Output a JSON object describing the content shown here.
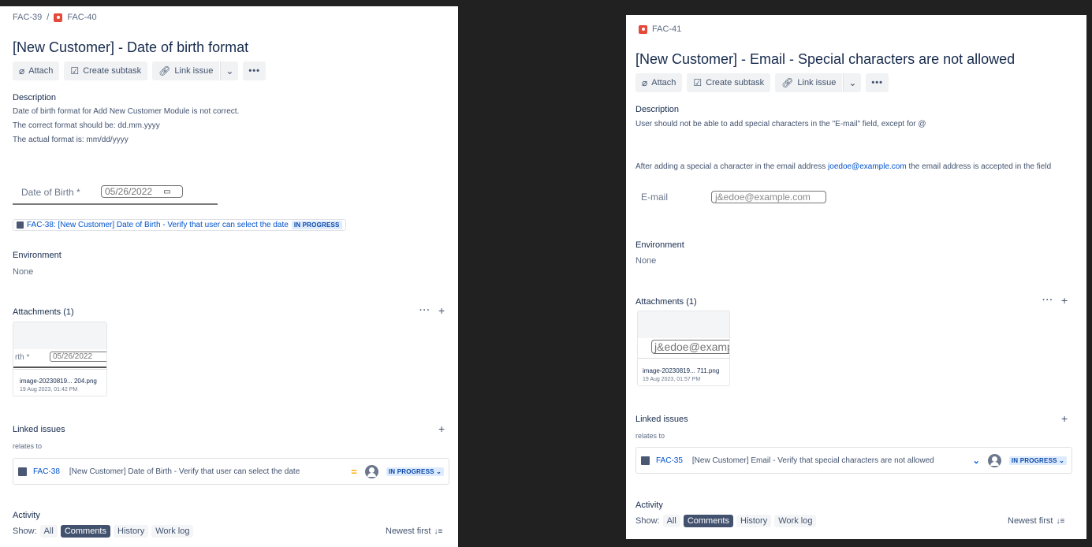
{
  "left": {
    "breadcrumb": {
      "parent": "FAC-39",
      "separator": "/",
      "current": "FAC-40"
    },
    "title": "[New Customer] - Date of birth format",
    "toolbar": {
      "attach": "Attach",
      "subtask": "Create subtask",
      "link": "Link issue"
    },
    "description": {
      "label": "Description",
      "lines": [
        "Date of birth format for Add New Customer Module is not correct.",
        "The correct format should be: dd.mm.yyyy",
        "The actual format is: mm/dd/yyyy"
      ]
    },
    "embedded_field": {
      "label": "Date of Birth *",
      "value": "05/26/2022"
    },
    "linked_chip": {
      "text": "FAC-38: [New Customer] Date of Birth - Verify that user can select the date",
      "status": "IN PROGRESS"
    },
    "environment": {
      "label": "Environment",
      "value": "None"
    },
    "attachments": {
      "label": "Attachments (1)",
      "file": {
        "crop_label": "rth *",
        "crop_value": "05/26/2022",
        "name": "image-20230819... 204.png",
        "date": "19 Aug 2023, 01:42 PM"
      }
    },
    "linked_issues": {
      "label": "Linked issues",
      "relation": "relates to",
      "issue": {
        "key": "FAC-38",
        "summary": "[New Customer] Date of Birth - Verify that user can select the date",
        "priority_icon": "priority-medium-icon",
        "status": "IN PROGRESS"
      }
    },
    "activity": {
      "label": "Activity",
      "show": "Show:",
      "filters": [
        "All",
        "Comments",
        "History",
        "Work log"
      ],
      "active_filter": "Comments",
      "sort": "Newest first"
    }
  },
  "right": {
    "breadcrumb": {
      "current": "FAC-41"
    },
    "title": "[New Customer] - Email - Special characters are not allowed",
    "toolbar": {
      "attach": "Attach",
      "subtask": "Create subtask",
      "link": "Link issue"
    },
    "description": {
      "label": "Description",
      "line1": "User should not be able to add special characters in the \"E-mail\" field, except for @",
      "line2_before": "After adding a special a character in the email address ",
      "line2_link": "joedoe@example.com",
      "line2_after": " the email address is accepted in the field"
    },
    "embedded_field": {
      "label": "E-mail",
      "value": "j&edoe@example.com"
    },
    "environment": {
      "label": "Environment",
      "value": "None"
    },
    "attachments": {
      "label": "Attachments (1)",
      "file": {
        "crop_value": "j&edoe@examp",
        "name": "image-20230819... 711.png",
        "date": "19 Aug 2023, 01:57 PM"
      }
    },
    "linked_issues": {
      "label": "Linked issues",
      "relation": "relates to",
      "issue": {
        "key": "FAC-35",
        "summary": "[New Customer] Email - Verify that special characters are not allowed",
        "priority_icon": "priority-low-icon",
        "status": "IN PROGRESS"
      }
    },
    "activity": {
      "label": "Activity",
      "show": "Show:",
      "filters": [
        "All",
        "Comments",
        "History",
        "Work log"
      ],
      "active_filter": "Comments",
      "sort": "Newest first"
    }
  },
  "colors": {
    "background": "#212121",
    "panel": "#ffffff",
    "link": "#0052cc",
    "bug": "#e5493a",
    "status_bg": "#deebff"
  }
}
